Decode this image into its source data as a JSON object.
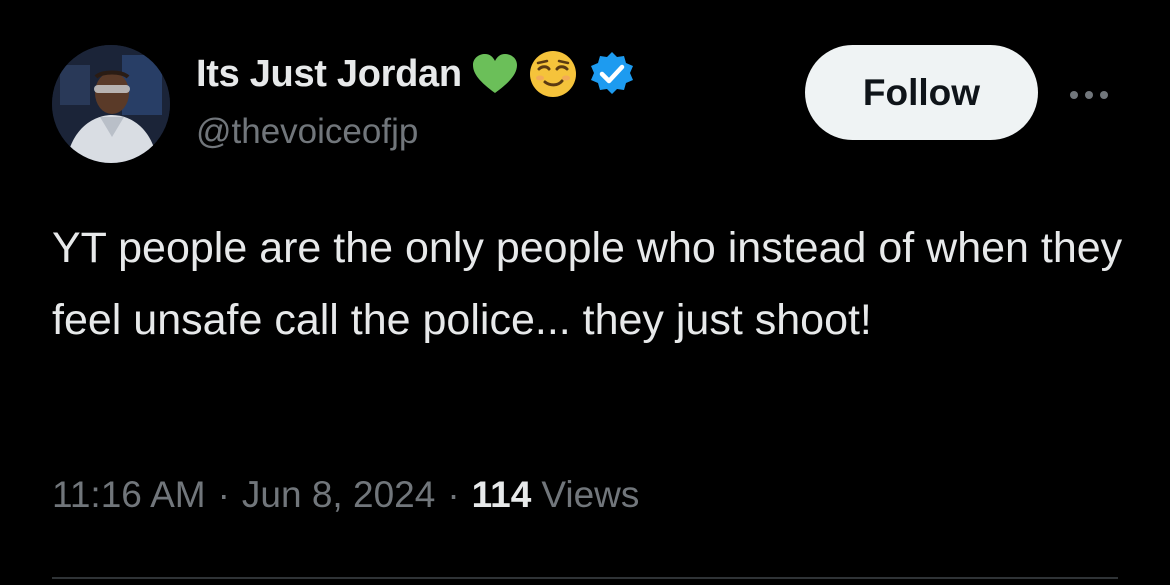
{
  "author": {
    "name": "Its Just Jordan",
    "handle": "@thevoiceofjp",
    "badges": [
      "green-heart-icon",
      "relieved-face-icon",
      "verified-badge-icon"
    ]
  },
  "actions": {
    "follow_label": "Follow",
    "more_icon": "more-options-icon"
  },
  "tweet": {
    "text": "YT people are the only people who instead of when they feel unsafe call the police... they just shoot!"
  },
  "meta": {
    "time": "11:16 AM",
    "separator": "·",
    "date": "Jun 8, 2024",
    "views_count": "114",
    "views_label": "Views"
  },
  "colors": {
    "background": "#000000",
    "text_primary": "#e7e9ea",
    "text_secondary": "#71767b",
    "follow_bg": "#eff3f4",
    "verified_blue": "#1d9bf0",
    "heart_green": "#6bbf59",
    "emoji_yellow": "#f5c33b",
    "divider": "#2f3336"
  }
}
